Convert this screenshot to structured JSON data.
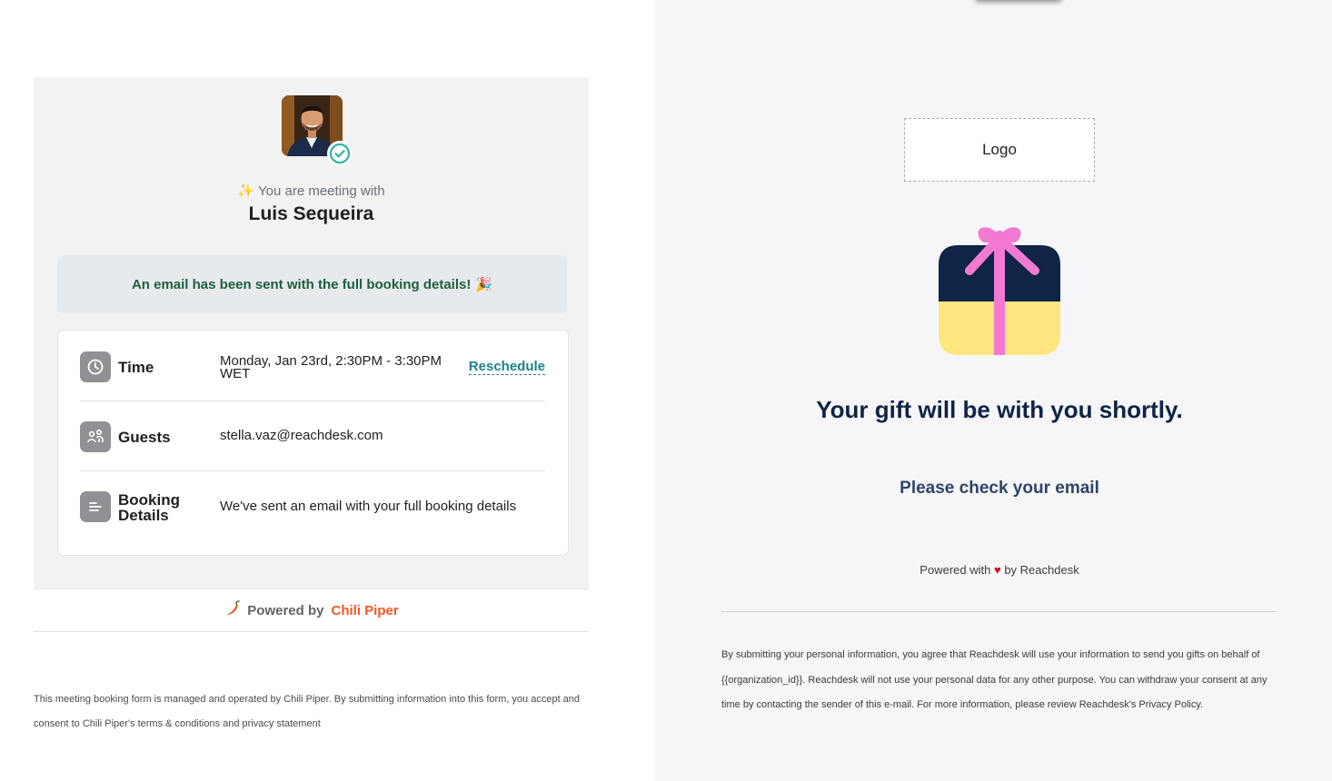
{
  "booking": {
    "meeting_with_label": "You are meeting with",
    "host_name": "Luis Sequeira",
    "email_sent_banner": "An email has been sent with the full booking details!",
    "rows": [
      {
        "label": "Time",
        "value_line1": "Monday, Jan 23rd, 2:30PM - 3:30PM",
        "value_line2": "WET",
        "action": "Reschedule",
        "icon": "clock-icon"
      },
      {
        "label": "Guests",
        "value": "stella.vaz@reachdesk.com",
        "icon": "guests-icon"
      },
      {
        "label_line1": "Booking",
        "label_line2": "Details",
        "value": "We've sent an email with your full booking details",
        "icon": "document-lines-icon"
      }
    ],
    "powered_by_label": "Powered by",
    "powered_by_brand": "Chili Piper",
    "legal_text": "This meeting booking form is managed and operated by Chili Piper. By submitting information into this form, you accept and consent to Chili Piper's terms & conditions and privacy statement"
  },
  "gift": {
    "logo_placeholder": "Logo",
    "title": "Your gift will be with you shortly.",
    "subtitle": "Please check your email",
    "powered_prefix": "Powered with",
    "powered_suffix": "by Reachdesk",
    "legal_text": "By submitting your personal information, you agree that Reachdesk will use your information to send you gifts on behalf of {{organization_id}}. Reachdesk will not use your personal data for any other purpose. You can withdraw your consent at any time by contacting the sender of this e-mail. For more information, please review Reachdesk's Privacy Policy."
  },
  "colors": {
    "accent_teal": "#1f7f8a",
    "success_green": "#1e5e3d",
    "chili_orange": "#f05a24",
    "gift_navy": "#0f2446",
    "gift_yellow": "#fde67f",
    "gift_pink": "#f37ad3"
  }
}
